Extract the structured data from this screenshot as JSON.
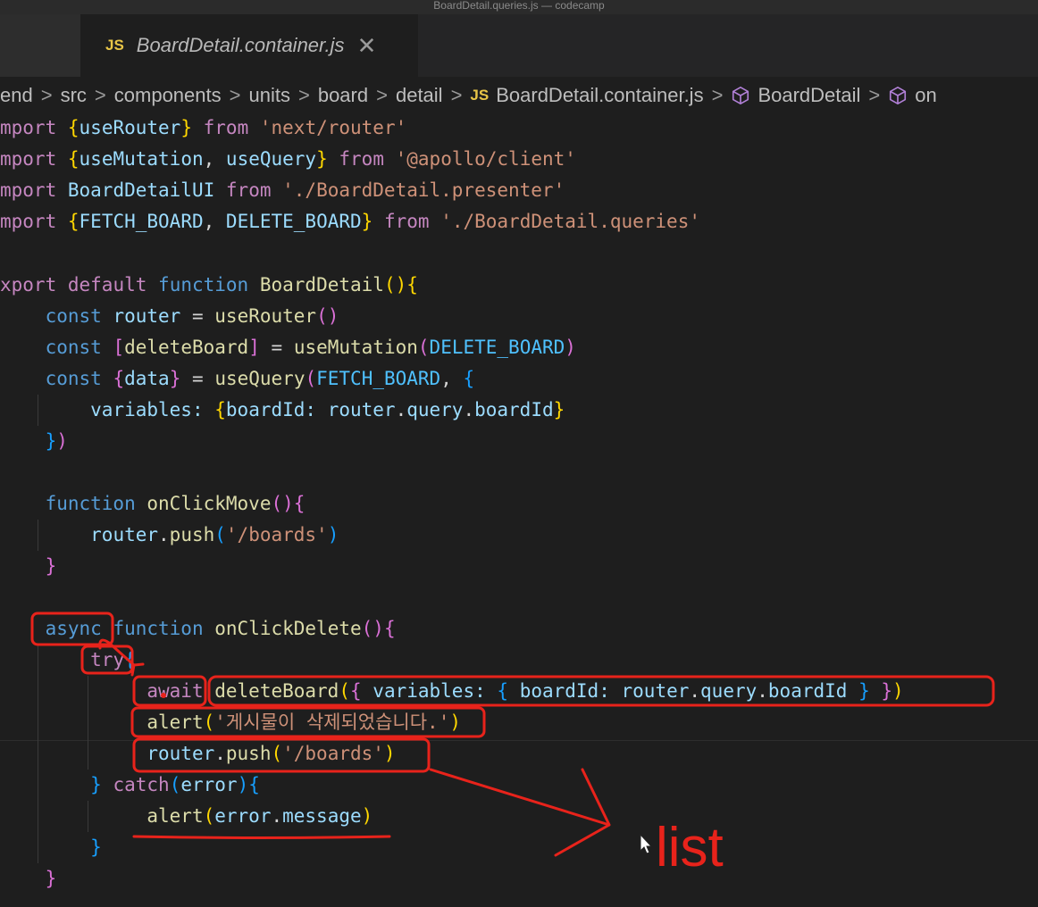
{
  "window": {
    "title": "BoardDetail.queries.js — codecamp"
  },
  "tab": {
    "badge": "JS",
    "title": "BoardDetail.container.js",
    "close": "✕"
  },
  "breadcrumb": {
    "items": [
      "end",
      "src",
      "components",
      "units",
      "board",
      "detail"
    ],
    "file_badge": "JS",
    "file": "BoardDetail.container.js",
    "symbol": "BoardDetail",
    "symbol2": "on",
    "separator": ">"
  },
  "code": {
    "l1": {
      "kw": "mport",
      "open": "{",
      "name": "useRouter",
      "close": "}",
      "from": "from",
      "src": "'next/router'"
    },
    "l2": {
      "kw": "mport",
      "open": "{",
      "n1": "useMutation",
      "comma": ",",
      "n2": "useQuery",
      "close": "}",
      "from": "from",
      "src": "'@apollo/client'"
    },
    "l3": {
      "kw": "mport",
      "name": "BoardDetailUI",
      "from": "from",
      "src": "'./BoardDetail.presenter'"
    },
    "l4": {
      "kw": "mport",
      "open": "{",
      "n1": "FETCH_BOARD",
      "comma": ",",
      "n2": "DELETE_BOARD",
      "close": "}",
      "from": "from",
      "src": "'./BoardDetail.queries'"
    },
    "l6": {
      "kw1": "xport",
      "kw2": "default",
      "kw3": "function",
      "name": "BoardDetail",
      "parens": "()",
      "brace": "{"
    },
    "l7": {
      "kw": "const",
      "var": "router",
      "eq": "=",
      "fn": "useRouter",
      "parens": "()"
    },
    "l8": {
      "kw": "const",
      "open": "[",
      "var": "deleteBoard",
      "close": "]",
      "eq": "=",
      "fn": "useMutation",
      "po": "(",
      "arg": "DELETE_BOARD",
      "pc": ")"
    },
    "l9": {
      "kw": "const",
      "open": "{",
      "var": "data",
      "close": "}",
      "eq": "=",
      "fn": "useQuery",
      "po": "(",
      "arg": "FETCH_BOARD",
      "comma": ",",
      "brace": "{"
    },
    "l10": {
      "key": "variables:",
      "bo": "{",
      "key2": "boardId:",
      "obj": "router",
      "d1": ".",
      "p1": "query",
      "d2": ".",
      "p2": "boardId",
      "bc": "}"
    },
    "l11": {
      "bc": "}",
      "pc": ")"
    },
    "l13": {
      "kw": "function",
      "name": "onClickMove",
      "parens": "()",
      "brace": "{"
    },
    "l14": {
      "obj": "router",
      "dot": ".",
      "fn": "push",
      "po": "(",
      "str": "'/boards'",
      "pc": ")"
    },
    "l15": {
      "bc": "}"
    },
    "l17": {
      "kw": "async",
      "kw2": "function",
      "name": "onClickDelete",
      "parens": "()",
      "brace": "{"
    },
    "l18": {
      "kw": "try",
      "brace": "{"
    },
    "l19": {
      "kw": "await",
      "fn": "deleteBoard",
      "po": "(",
      "b1": "{",
      "key": "variables:",
      "b2": "{",
      "key2": "boardId:",
      "obj": "router",
      "d1": ".",
      "p1": "query",
      "d2": ".",
      "p2": "boardId",
      "b3": "}",
      "b4": "}",
      "pc": ")"
    },
    "l20": {
      "fn": "alert",
      "po": "(",
      "str": "'게시물이 삭제되었습니다.'",
      "pc": ")"
    },
    "l21": {
      "obj": "router",
      "dot": ".",
      "fn": "push",
      "po": "(",
      "str": "'/boards'",
      "pc": ")"
    },
    "l22": {
      "bc": "}",
      "kw": "catch",
      "po": "(",
      "var": "error",
      "pc": ")",
      "brace": "{"
    },
    "l23": {
      "fn": "alert",
      "po": "(",
      "obj": "error",
      "dot": ".",
      "prop": "message",
      "pc": ")"
    },
    "l24": {
      "bc": "}"
    },
    "l25": {
      "bc": "}"
    }
  },
  "annotation": {
    "text": "list",
    "color": "#e8231b"
  }
}
